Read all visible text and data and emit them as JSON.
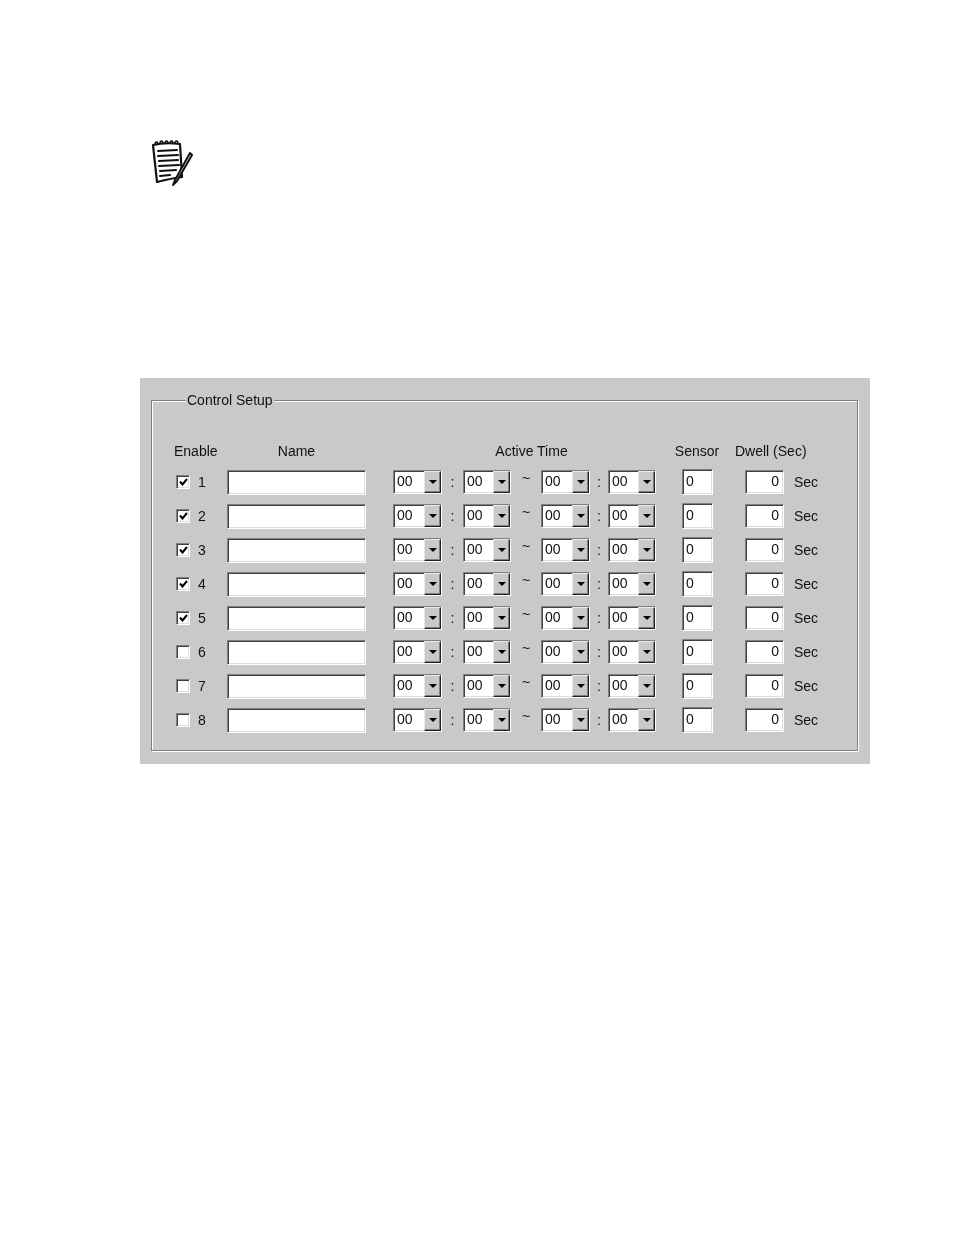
{
  "control_setup": {
    "title": "Control Setup",
    "columns": {
      "enable": "Enable",
      "name": "Name",
      "active_time": "Active Time",
      "sensor": "Sensor",
      "dwell": "Dwell (Sec)"
    },
    "rows": [
      {
        "checked": true,
        "number": "1",
        "start_hour": "00",
        "start_separator": ":",
        "start_minute": "00",
        "range_separator": "~",
        "end_hour": "00",
        "end_separator": ":",
        "end_minute": "00",
        "sensor": "0",
        "dwell": "0",
        "unit": "Sec"
      },
      {
        "checked": true,
        "number": "2",
        "start_hour": "00",
        "start_separator": ":",
        "start_minute": "00",
        "range_separator": "~",
        "end_hour": "00",
        "end_separator": ":",
        "end_minute": "00",
        "sensor": "0",
        "dwell": "0",
        "unit": "Sec"
      },
      {
        "checked": true,
        "number": "3",
        "start_hour": "00",
        "start_separator": ":",
        "start_minute": "00",
        "range_separator": "~",
        "end_hour": "00",
        "end_separator": ":",
        "end_minute": "00",
        "sensor": "0",
        "dwell": "0",
        "unit": "Sec"
      },
      {
        "checked": true,
        "number": "4",
        "start_hour": "00",
        "start_separator": ":",
        "start_minute": "00",
        "range_separator": "~",
        "end_hour": "00",
        "end_separator": ":",
        "end_minute": "00",
        "sensor": "0",
        "dwell": "0",
        "unit": "Sec"
      },
      {
        "checked": true,
        "number": "5",
        "start_hour": "00",
        "start_separator": ":",
        "start_minute": "00",
        "range_separator": "~",
        "end_hour": "00",
        "end_separator": ":",
        "end_minute": "00",
        "sensor": "0",
        "dwell": "0",
        "unit": "Sec"
      },
      {
        "checked": false,
        "number": "6",
        "start_hour": "00",
        "start_separator": ":",
        "start_minute": "00",
        "range_separator": "~",
        "end_hour": "00",
        "end_separator": ":",
        "end_minute": "00",
        "sensor": "0",
        "dwell": "0",
        "unit": "Sec"
      },
      {
        "checked": false,
        "number": "7",
        "start_hour": "00",
        "start_separator": ":",
        "start_minute": "00",
        "range_separator": "~",
        "end_hour": "00",
        "end_separator": ":",
        "end_minute": "00",
        "sensor": "0",
        "dwell": "0",
        "unit": "Sec"
      },
      {
        "checked": false,
        "number": "8",
        "start_hour": "00",
        "start_separator": ":",
        "start_minute": "00",
        "range_separator": "~",
        "end_hour": "00",
        "end_separator": ":",
        "end_minute": "00",
        "sensor": "0",
        "dwell": "0",
        "unit": "Sec"
      }
    ]
  }
}
